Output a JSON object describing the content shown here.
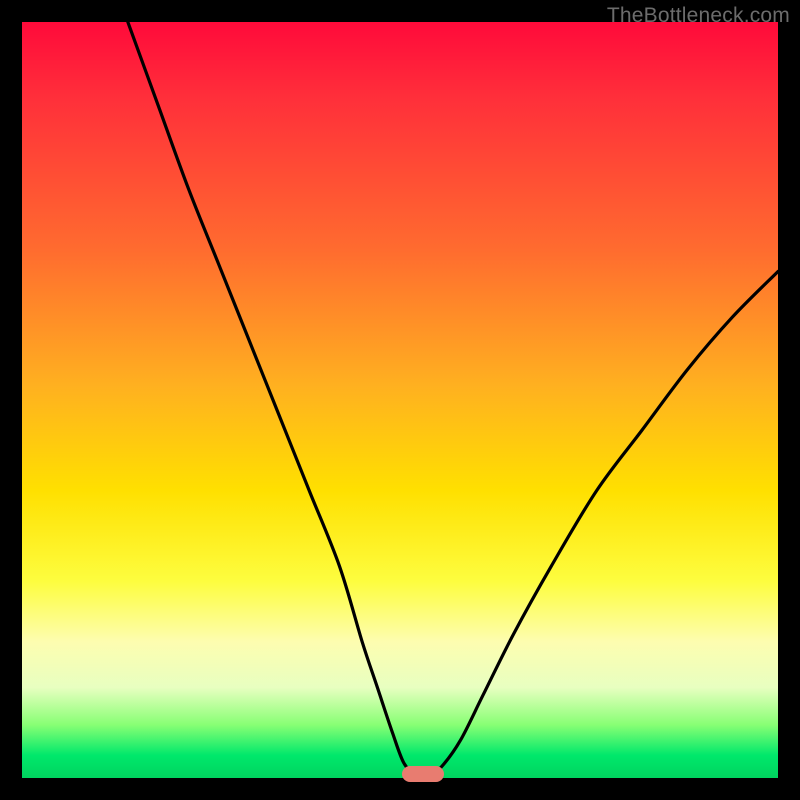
{
  "attribution": "TheBottleneck.com",
  "chart_data": {
    "type": "line",
    "title": "",
    "xlabel": "",
    "ylabel": "",
    "xlim": [
      0,
      100
    ],
    "ylim": [
      0,
      100
    ],
    "series": [
      {
        "name": "bottleneck-curve",
        "x": [
          14,
          18,
          22,
          26,
          30,
          34,
          38,
          42,
          45,
          47,
          49,
          50.5,
          52,
          53,
          54,
          55.5,
          58,
          61,
          65,
          70,
          76,
          82,
          88,
          94,
          100
        ],
        "values": [
          100,
          89,
          78,
          68,
          58,
          48,
          38,
          28,
          18,
          12,
          6,
          2,
          0.5,
          0.5,
          0.5,
          1.5,
          5,
          11,
          19,
          28,
          38,
          46,
          54,
          61,
          67
        ]
      }
    ],
    "marker": {
      "x": 53,
      "y": 0.5
    },
    "background_gradient": {
      "stops": [
        {
          "color": "#ff0a3a",
          "pos": 0
        },
        {
          "color": "#ffe000",
          "pos": 62
        },
        {
          "color": "#00d45f",
          "pos": 100
        }
      ]
    }
  }
}
